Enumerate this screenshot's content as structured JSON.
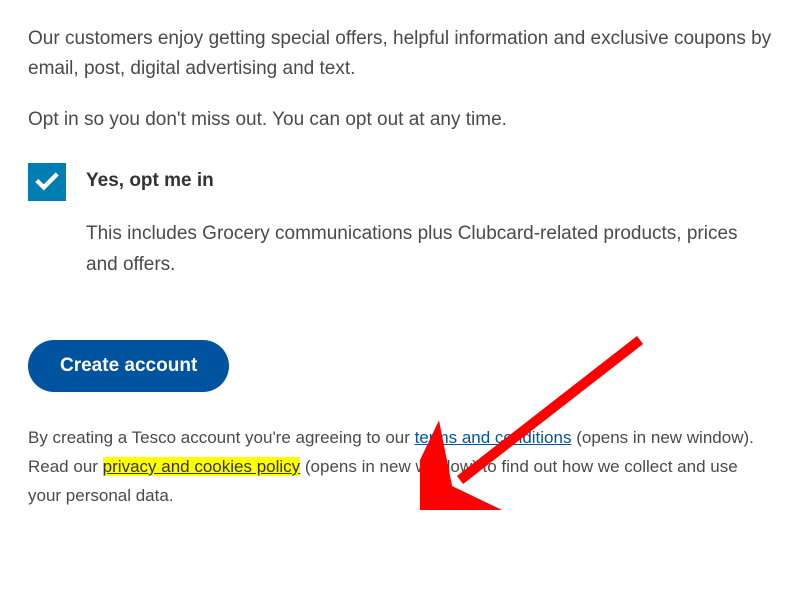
{
  "intro": "Our customers enjoy getting special offers, helpful information and exclusive coupons by email, post, digital advertising and text.",
  "optText": "Opt in so you don't miss out. You can opt out at any time.",
  "checkbox": {
    "label": "Yes, opt me in",
    "description": "This includes Grocery communications plus Clubcard-related products, prices and offers."
  },
  "createButton": "Create account",
  "legal": {
    "part1": "By creating a Tesco account you're agreeing to our ",
    "termsLink": "terms and conditions",
    "part2": " (opens in new window). Read our ",
    "privacyLink": "privacy and cookies policy",
    "part3": " (opens in new window) to find out how we collect and use your personal data."
  },
  "colors": {
    "checkbox": "#007eb3",
    "button": "#00539f",
    "highlight": "#ffff00",
    "arrow": "#ff0000"
  }
}
